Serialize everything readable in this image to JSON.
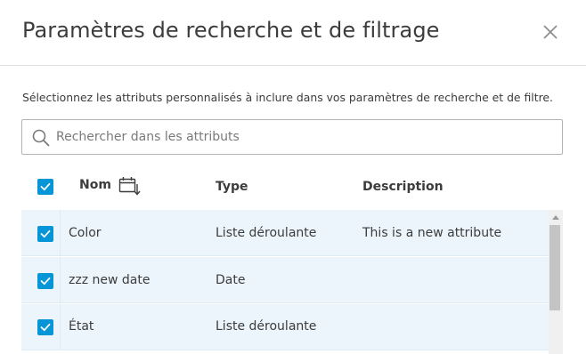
{
  "dialog": {
    "title": "Paramètres de recherche et de filtrage",
    "close_icon": "close-icon",
    "description": "Sélectionnez les attributs personnalisés à inclure dans vos paramètres de recherche et de filtre."
  },
  "search": {
    "placeholder": "Rechercher dans les attributs",
    "value": "",
    "icon": "search-icon"
  },
  "table": {
    "select_all_checked": true,
    "columns": {
      "name": "Nom",
      "type": "Type",
      "description": "Description"
    },
    "sort_icon": "calendar-sort-icon",
    "rows": [
      {
        "checked": true,
        "name": "Color",
        "type": "Liste déroulante",
        "description": "This is a new attribute"
      },
      {
        "checked": true,
        "name": "zzz new date",
        "type": "Date",
        "description": ""
      },
      {
        "checked": true,
        "name": "État",
        "type": "Liste déroulante",
        "description": ""
      }
    ]
  },
  "colors": {
    "accent": "#0696d7",
    "row_background": "#ebf5fb",
    "text": "#3c3c3c"
  }
}
